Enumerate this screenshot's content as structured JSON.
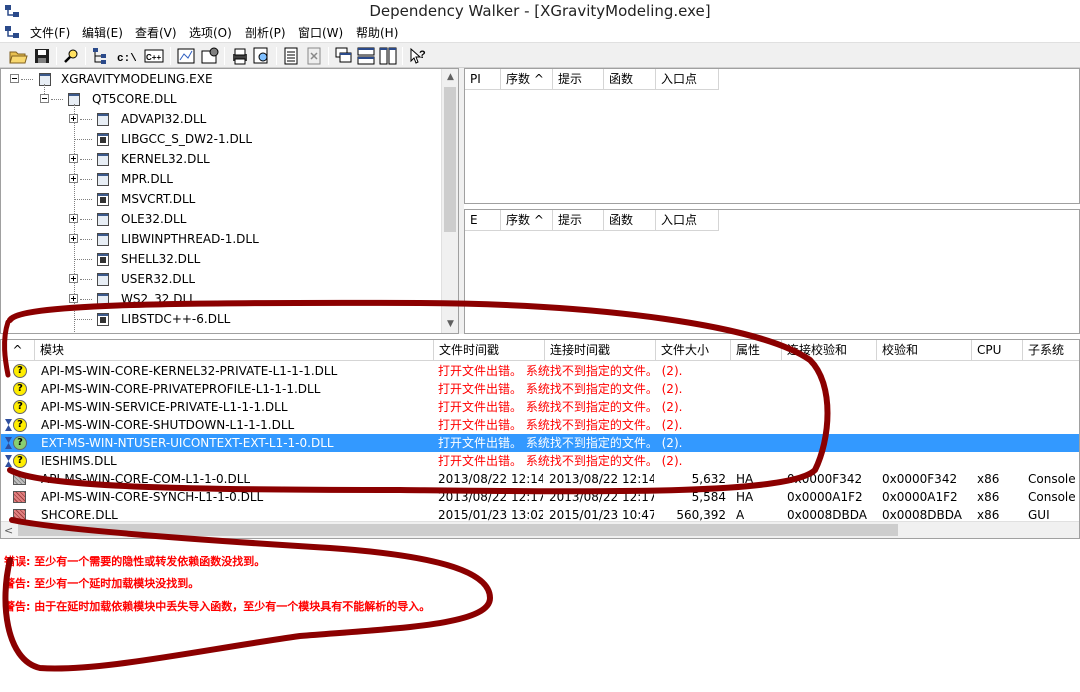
{
  "window": {
    "title": "Dependency Walker - [XGravityModeling.exe]"
  },
  "menu": [
    "文件(F)",
    "编辑(E)",
    "查看(V)",
    "选项(O)",
    "剖析(P)",
    "窗口(W)",
    "帮助(H)"
  ],
  "toolbar": {
    "buttons": [
      "open-icon",
      "save-icon",
      "find-icon",
      "tree-icon",
      "c-path-icon",
      "cpp-icon",
      "properties-icon",
      "options-icon",
      "print-icon",
      "search-icon",
      "list-icon",
      "cancel-icon",
      "cascade-icon",
      "tile-horizontal-icon",
      "tile-vertical-icon",
      "help-icon"
    ],
    "c_label": "c:\\",
    "cpp_label": "C++"
  },
  "tree": {
    "root": "XGRAVITYMODELING.EXE",
    "child": "QT5CORE.DLL",
    "items": [
      {
        "label": "ADVAPI32.DLL",
        "expandable": true
      },
      {
        "label": "LIBGCC_S_DW2-1.DLL",
        "expandable": false
      },
      {
        "label": "KERNEL32.DLL",
        "expandable": true
      },
      {
        "label": "MPR.DLL",
        "expandable": true
      },
      {
        "label": "MSVCRT.DLL",
        "expandable": false
      },
      {
        "label": "OLE32.DLL",
        "expandable": true
      },
      {
        "label": "LIBWINPTHREAD-1.DLL",
        "expandable": true
      },
      {
        "label": "SHELL32.DLL",
        "expandable": false
      },
      {
        "label": "USER32.DLL",
        "expandable": true
      },
      {
        "label": "WS2_32.DLL",
        "expandable": true
      },
      {
        "label": "LIBSTDC++-6.DLL",
        "expandable": false
      }
    ]
  },
  "pi_pane": {
    "headers": [
      "PI",
      "序数 ^",
      "提示",
      "函数",
      "入口点"
    ]
  },
  "e_pane": {
    "headers": [
      "E",
      "序数 ^",
      "提示",
      "函数",
      "入口点"
    ]
  },
  "modules": {
    "headers": [
      "^",
      "模块",
      "文件时间戳",
      "连接时间戳",
      "文件大小",
      "属性",
      "连接校验和",
      "校验和",
      "CPU",
      "子系统"
    ],
    "rows": [
      {
        "icon": "question",
        "hourglass": false,
        "name": "API-MS-WIN-CORE-KERNEL32-PRIVATE-L1-1-1.DLL",
        "error": "打开文件出错。 系统找不到指定的文件。 (2).",
        "selected": false
      },
      {
        "icon": "question",
        "hourglass": false,
        "name": "API-MS-WIN-CORE-PRIVATEPROFILE-L1-1-1.DLL",
        "error": "打开文件出错。 系统找不到指定的文件。 (2).",
        "selected": false
      },
      {
        "icon": "question",
        "hourglass": false,
        "name": "API-MS-WIN-SERVICE-PRIVATE-L1-1-1.DLL",
        "error": "打开文件出错。 系统找不到指定的文件。 (2).",
        "selected": false
      },
      {
        "icon": "question",
        "hourglass": true,
        "name": "API-MS-WIN-CORE-SHUTDOWN-L1-1-1.DLL",
        "error": "打开文件出错。 系统找不到指定的文件。 (2).",
        "selected": false
      },
      {
        "icon": "question-green",
        "hourglass": true,
        "name": "EXT-MS-WIN-NTUSER-UICONTEXT-EXT-L1-1-0.DLL",
        "error": "打开文件出错。 系统找不到指定的文件。 (2).",
        "selected": true
      },
      {
        "icon": "question",
        "hourglass": true,
        "name": "IESHIMS.DLL",
        "error": "打开文件出错。 系统找不到指定的文件。 (2).",
        "selected": false
      },
      {
        "icon": "file",
        "hourglass": false,
        "name": "API-MS-WIN-CORE-COM-L1-1-0.DLL",
        "filetime": "2013/08/22 12:14",
        "linktime": "2013/08/22 12:14",
        "size": "5,632",
        "attr": "HA",
        "linkcsum": "0x0000F342",
        "csum": "0x0000F342",
        "cpu": "x86",
        "subsystem": "Console",
        "selected": false
      },
      {
        "icon": "file-red",
        "hourglass": false,
        "name": "API-MS-WIN-CORE-SYNCH-L1-1-0.DLL",
        "filetime": "2013/08/22 12:17",
        "linktime": "2013/08/22 12:17",
        "size": "5,584",
        "attr": "HA",
        "linkcsum": "0x0000A1F2",
        "csum": "0x0000A1F2",
        "cpu": "x86",
        "subsystem": "Console",
        "selected": false
      },
      {
        "icon": "file-red",
        "hourglass": false,
        "name": "SHCORE.DLL",
        "filetime": "2015/01/23 13:02",
        "linktime": "2015/01/23 10:47",
        "size": "560,392",
        "attr": "A",
        "linkcsum": "0x0008DBDA",
        "csum": "0x0008DBDA",
        "cpu": "x86",
        "subsystem": "GUI",
        "selected": false
      }
    ]
  },
  "log": [
    "错误: 至少有一个需要的隐性或转发依赖函数没找到。",
    "警告: 至少有一个延时加载模块没找到。",
    "警告: 由于在延时加载依赖模块中丢失导入函数，至少有一个模块具有不能解析的导入。"
  ],
  "colors": {
    "selection": "#3399ff",
    "error_text": "#ff0000",
    "annotation": "#8b0000"
  }
}
